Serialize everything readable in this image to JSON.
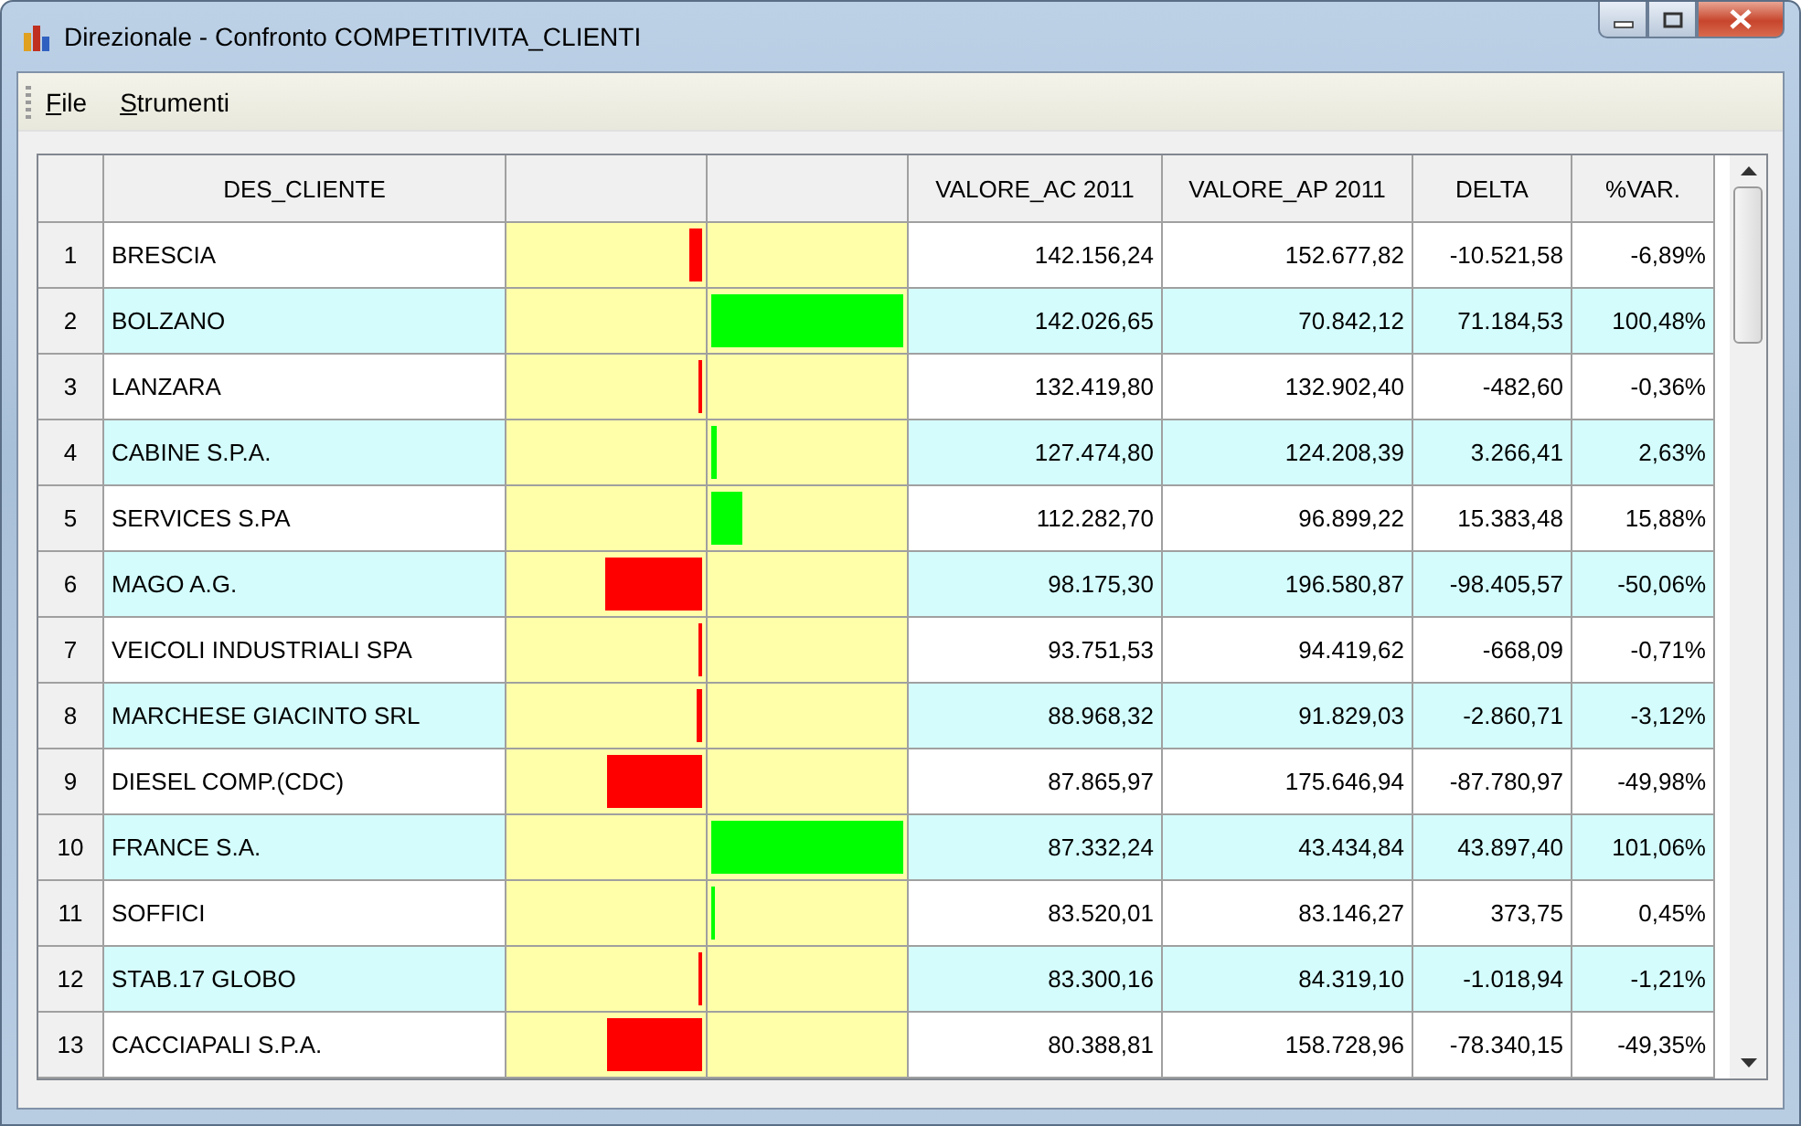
{
  "window": {
    "title": "Direzionale - Confronto COMPETITIVITA_CLIENTI"
  },
  "menu": [
    "File",
    "Strumenti"
  ],
  "table": {
    "columns": [
      "DES_CLIENTE",
      "VALORE_AC 2011",
      "VALORE_AP 2011",
      "DELTA",
      "%VAR."
    ],
    "rows": [
      {
        "number": "1",
        "cliente": "BRESCIA",
        "bar": {
          "kind": "negative",
          "level": 0.069
        },
        "valore_ac": "142.156,24",
        "valore_ap": "152.677,82",
        "delta": "-10.521,58",
        "var": "-6,89%"
      },
      {
        "number": "2",
        "cliente": "BOLZANO",
        "bar": {
          "kind": "positive",
          "level": 1
        },
        "valore_ac": "142.026,65",
        "valore_ap": "70.842,12",
        "delta": "71.184,53",
        "var": "100,48%"
      },
      {
        "number": "3",
        "cliente": "LANZARA",
        "bar": {
          "kind": "negative",
          "level": 0.004
        },
        "valore_ac": "132.419,80",
        "valore_ap": "132.902,40",
        "delta": "-482,60",
        "var": "-0,36%"
      },
      {
        "number": "4",
        "cliente": "CABINE S.P.A.",
        "bar": {
          "kind": "positive",
          "level": 0.026
        },
        "valore_ac": "127.474,80",
        "valore_ap": "124.208,39",
        "delta": "3.266,41",
        "var": "2,63%"
      },
      {
        "number": "5",
        "cliente": "SERVICES S.PA",
        "bar": {
          "kind": "positive",
          "level": 0.159
        },
        "valore_ac": "112.282,70",
        "valore_ap": "96.899,22",
        "delta": "15.383,48",
        "var": "15,88%"
      },
      {
        "number": "6",
        "cliente": "MAGO A.G.",
        "bar": {
          "kind": "negative",
          "level": 0.501
        },
        "valore_ac": "98.175,30",
        "valore_ap": "196.580,87",
        "delta": "-98.405,57",
        "var": "-50,06%"
      },
      {
        "number": "7",
        "cliente": "VEICOLI INDUSTRIALI SPA",
        "bar": {
          "kind": "negative",
          "level": 0.007
        },
        "valore_ac": "93.751,53",
        "valore_ap": "94.419,62",
        "delta": "-668,09",
        "var": "-0,71%"
      },
      {
        "number": "8",
        "cliente": "MARCHESE GIACINTO SRL",
        "bar": {
          "kind": "negative",
          "level": 0.031
        },
        "valore_ac": "88.968,32",
        "valore_ap": "91.829,03",
        "delta": "-2.860,71",
        "var": "-3,12%"
      },
      {
        "number": "9",
        "cliente": "DIESEL COMP.(CDC)",
        "bar": {
          "kind": "negative",
          "level": 0.5
        },
        "valore_ac": "87.865,97",
        "valore_ap": "175.646,94",
        "delta": "-87.780,97",
        "var": "-49,98%"
      },
      {
        "number": "10",
        "cliente": "FRANCE S.A.",
        "bar": {
          "kind": "positive",
          "level": 1
        },
        "valore_ac": "87.332,24",
        "valore_ap": "43.434,84",
        "delta": "43.897,40",
        "var": "101,06%"
      },
      {
        "number": "11",
        "cliente": "SOFFICI",
        "bar": {
          "kind": "positive",
          "level": 0.005
        },
        "valore_ac": "83.520,01",
        "valore_ap": "83.146,27",
        "delta": "373,75",
        "var": "0,45%"
      },
      {
        "number": "12",
        "cliente": "STAB.17 GLOBO",
        "bar": {
          "kind": "negative",
          "level": 0.012
        },
        "valore_ac": "83.300,16",
        "valore_ap": "84.319,10",
        "delta": "-1.018,94",
        "var": "-1,21%"
      },
      {
        "number": "13",
        "cliente": "CACCIAPALI S.P.A.",
        "bar": {
          "kind": "negative",
          "level": 0.494
        },
        "valore_ac": "80.388,81",
        "valore_ap": "158.728,96",
        "delta": "-78.340,15",
        "var": "-49,35%"
      }
    ]
  }
}
